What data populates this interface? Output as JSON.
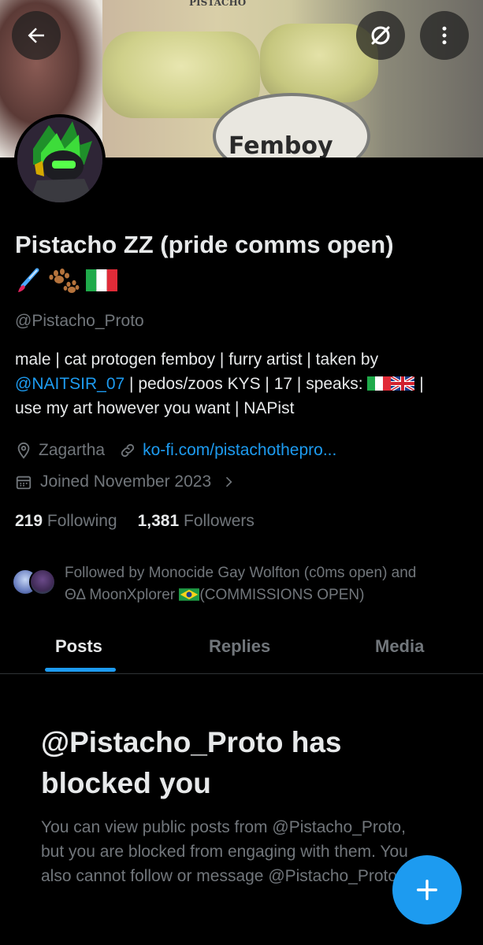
{
  "banner": {
    "top_text": "PISTACHO",
    "sign_text": "Femboy"
  },
  "profile": {
    "display_name": "Pistacho ZZ (pride comms open)",
    "handle": "@Pistacho_Proto",
    "bio_part1": "male |  cat protogen femboy | furry artist | taken by",
    "bio_mention": "@NAITSIR_07",
    "bio_part2": " | pedos/zoos KYS | 17 | speaks: ",
    "bio_part3": " |",
    "bio_line3": "use my art however you want | NAPist",
    "location": "Zagartha",
    "website": "ko-fi.com/pistachothepro...",
    "joined": "Joined November 2023",
    "following_count": "219",
    "following_label": "Following",
    "followers_count": "1,381",
    "followers_label": "Followers",
    "followed_by_line1": "Followed by Monocide Gay Wolfton (c0ms open) and",
    "followed_by_line2": "ΘΔ MoonXplorer ",
    "followed_by_line2b": "(COMMISSIONS OPEN)"
  },
  "tabs": [
    {
      "label": "Posts"
    },
    {
      "label": "Replies"
    },
    {
      "label": "Media"
    }
  ],
  "blocked": {
    "title": "@Pistacho_Proto has blocked you",
    "message": "You can view public posts from @Pistacho_Proto, but you are blocked from engaging with them. You also cannot follow or message @Pistacho_Proto."
  },
  "icons": {
    "back": "back-arrow-icon",
    "grok": "slash-circle-icon",
    "more": "more-vertical-icon",
    "location": "location-pin-icon",
    "link": "link-icon",
    "calendar": "calendar-icon",
    "fab": "plus-icon"
  },
  "colors": {
    "accent": "#1d9bf0",
    "muted": "#71767b",
    "text": "#e7e9ea",
    "background": "#000000"
  }
}
